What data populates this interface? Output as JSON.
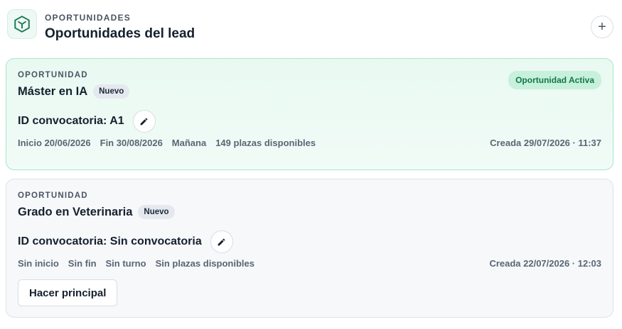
{
  "header": {
    "kicker": "OPORTUNIDADES",
    "title": "Oportunidades del lead",
    "logo_icon": "cube-icon",
    "add_label": "+"
  },
  "colors": {
    "brand": "#1a7a55",
    "active_bg": "#e9f9f1",
    "active_border": "#a9e6c9",
    "status_active": "#0f7a45"
  },
  "opportunities": [
    {
      "kicker": "OPORTUNIDAD",
      "title": "Máster en IA",
      "badge": "Nuevo",
      "status": "Oportunidad Activa",
      "convocatoria": "ID convocatoria: A1",
      "meta": {
        "start": "Inicio 20/06/2026",
        "end": "Fin 30/08/2026",
        "shift": "Mañana",
        "seats": "149 plazas disponibles"
      },
      "created": "Creada 29/07/2026 · 11:37"
    },
    {
      "kicker": "OPORTUNIDAD",
      "title": "Grado en Veterinaria",
      "badge": "Nuevo",
      "convocatoria": "ID convocatoria: Sin convocatoria",
      "meta": {
        "start": "Sin inicio",
        "end": "Sin fin",
        "shift": "Sin turno",
        "seats": "Sin plazas disponibles"
      },
      "created": "Creada 22/07/2026 · 12:03",
      "primary_button": "Hacer principal"
    }
  ]
}
